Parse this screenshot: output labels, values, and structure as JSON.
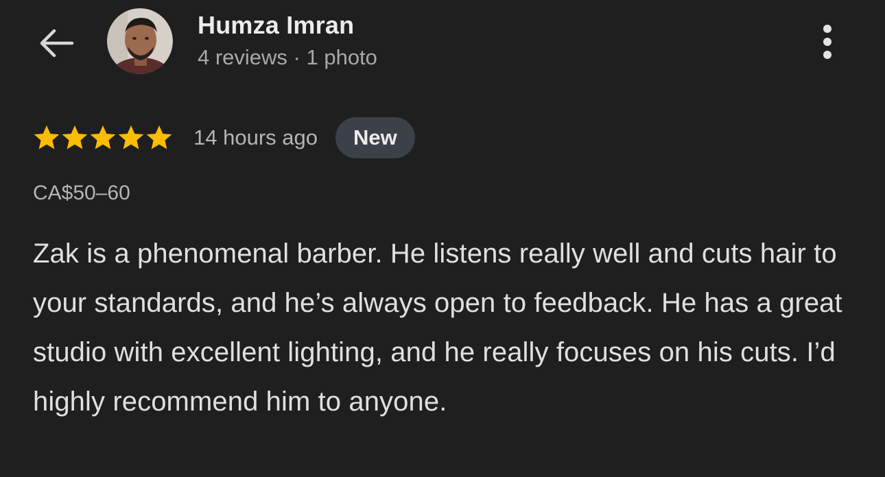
{
  "header": {
    "reviewer_name": "Humza Imran",
    "reviewer_meta": "4 reviews · 1 photo",
    "back_icon": "arrow-left-icon",
    "more_icon": "more-vertical-icon",
    "avatar": "reviewer-profile-photo"
  },
  "review": {
    "rating": 5,
    "rating_max": 5,
    "time_ago": "14 hours ago",
    "badge": "New",
    "price_range": "CA$50–60",
    "text": "Zak is a phenomenal barber. He listens really well and cuts hair to your standards, and he’s always open to feedback. He has a great studio with excellent lighting, and he really focuses on his cuts. I’d highly recommend him to anyone."
  },
  "colors": {
    "background": "#1f1f1f",
    "star": "#fbbc04",
    "badge_background": "#3c4047",
    "primary_text": "#e3e3e3",
    "secondary_text": "#a9a9a9"
  }
}
